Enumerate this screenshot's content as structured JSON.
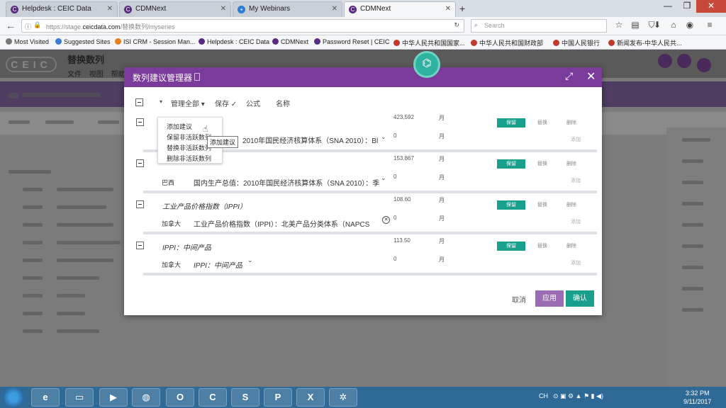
{
  "browser": {
    "tabs": [
      {
        "label": "Helpdesk : CEIC Data"
      },
      {
        "label": "CDMNext"
      },
      {
        "label": "My Webinars"
      },
      {
        "label": "CDMNext"
      }
    ],
    "url_prefix": "https://stage.",
    "url_domain": "ceicdata.com",
    "url_suffix": "/替换数列/myseries",
    "search_placeholder": "Search",
    "bookmarks": [
      {
        "label": "Most Visited"
      },
      {
        "label": "Suggested Sites"
      },
      {
        "label": "ISI CRM - Session Man..."
      },
      {
        "label": "Helpdesk : CEIC Data"
      },
      {
        "label": "CDMNext"
      },
      {
        "label": "Password Reset | CEIC"
      },
      {
        "label": "中华人民共和国国家..."
      },
      {
        "label": "中华人民共和国财政部"
      },
      {
        "label": "中国人民银行"
      },
      {
        "label": "新闻发布-中华人民共..."
      }
    ]
  },
  "app": {
    "logo": "CEIC",
    "title": "替换数列",
    "menu": [
      "文件",
      "视图",
      "帮助"
    ]
  },
  "modal": {
    "title": "数列建议管理器",
    "manage_all": "管理全部",
    "save": "保存",
    "formula": "公式",
    "name": "名称",
    "cancel": "取消",
    "apply": "应用",
    "confirm": "确认",
    "context_menu": [
      "添加建议",
      "保留非活跃数列",
      "替换非活跃数列",
      "删除非活跃数列"
    ],
    "tooltip": "添加建议",
    "groups": [
      {
        "name": "",
        "value": "423,592",
        "value2": "0",
        "freq": "月",
        "freq2": "月",
        "country": "",
        "series": "：2010年国民经济核算体系（SNA 2010）：Bl",
        "btn": "保留",
        "replace": "替换",
        "delete": "删除",
        "add": "添加"
      },
      {
        "name": "",
        "value": "153.867",
        "value2": "0",
        "freq": "月",
        "freq2": "月",
        "country": "巴西",
        "series": "国内生产总值：2010年国民经济核算体系（SNA 2010）：季",
        "btn": "保留",
        "replace": "替换",
        "delete": "删除",
        "add": "添加"
      },
      {
        "name": "工业产品价格指数（IPPI）",
        "value": "108.60",
        "value2": "0",
        "freq": "月",
        "freq2": "月",
        "country": "加拿大",
        "series": "工业产品价格指数（IPPI）：北美产品分类体系（NAPCS",
        "btn": "保留",
        "replace": "替换",
        "delete": "删除",
        "add": "添加"
      },
      {
        "name": "IPPI：中间产品",
        "value": "113.50",
        "value2": "0",
        "freq": "月",
        "freq2": "月",
        "country": "加拿大",
        "series": "IPPI：中间产品",
        "btn": "保留",
        "replace": "替换",
        "delete": "删除",
        "add": "添加"
      }
    ]
  },
  "taskbar": {
    "lang": "CH",
    "time": "3:32 PM",
    "date": "9/11/2017"
  },
  "colors": {
    "modal_header": "#7a3b9a",
    "teal": "#18a08c",
    "apply_purple": "#9b6bb3"
  }
}
